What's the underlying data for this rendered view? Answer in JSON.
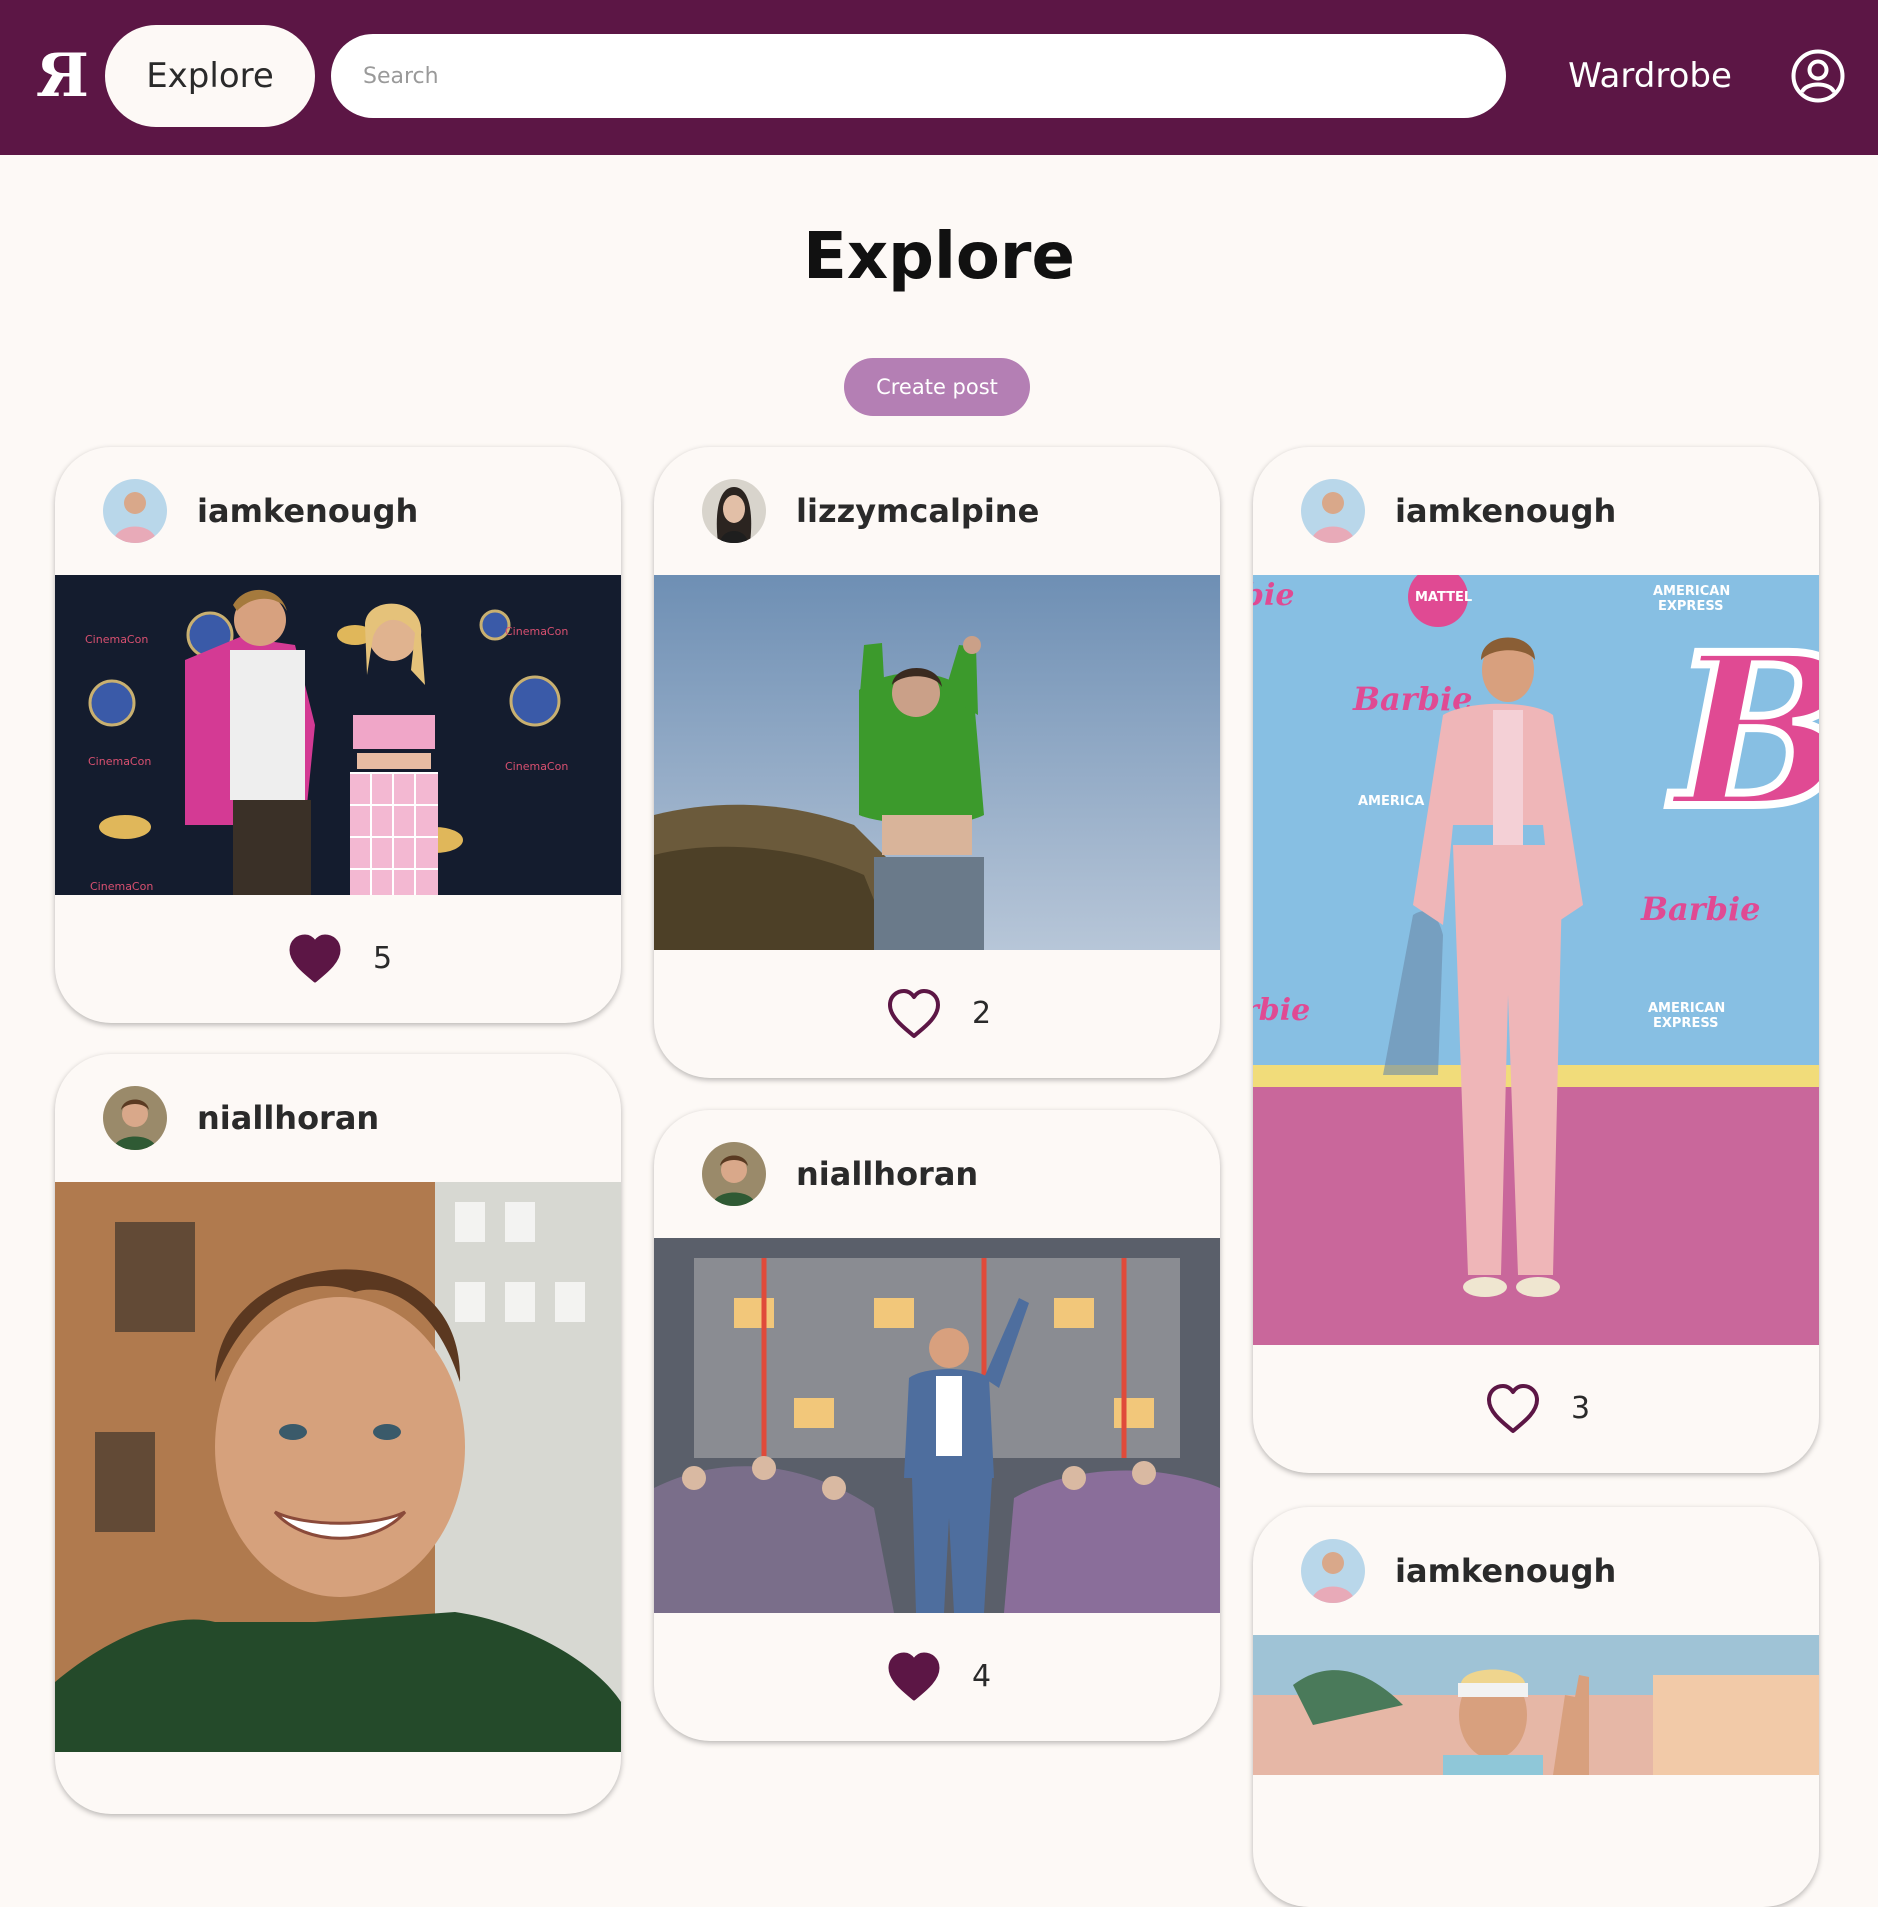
{
  "header": {
    "logo_text": "Я",
    "nav_explore": "Explore",
    "search_placeholder": "Search",
    "nav_wardrobe": "Wardrobe"
  },
  "page": {
    "title": "Explore",
    "create_post_label": "Create post"
  },
  "colors": {
    "brand": "#5c1645",
    "accent": "#b47fb4",
    "background": "#fdf9f6"
  },
  "posts": [
    {
      "username": "iamkenough",
      "likes": "5",
      "liked": true,
      "photo": "Ryan Gosling and Margot Robbie at CinemaCon"
    },
    {
      "username": "lizzymcalpine",
      "likes": "2",
      "liked": false,
      "photo": "Woman in green sweater against blue sky"
    },
    {
      "username": "iamkenough",
      "likes": "3",
      "liked": false,
      "photo": "Man in pink suit at Barbie premiere"
    },
    {
      "username": "niallhoran",
      "likes": "",
      "liked": false,
      "photo": "Smiling man in green shirt"
    },
    {
      "username": "niallhoran",
      "likes": "4",
      "liked": true,
      "photo": "Performer in denim on stage with crowd"
    },
    {
      "username": "iamkenough",
      "likes": "",
      "liked": false,
      "photo": "Man with headband waving"
    }
  ]
}
